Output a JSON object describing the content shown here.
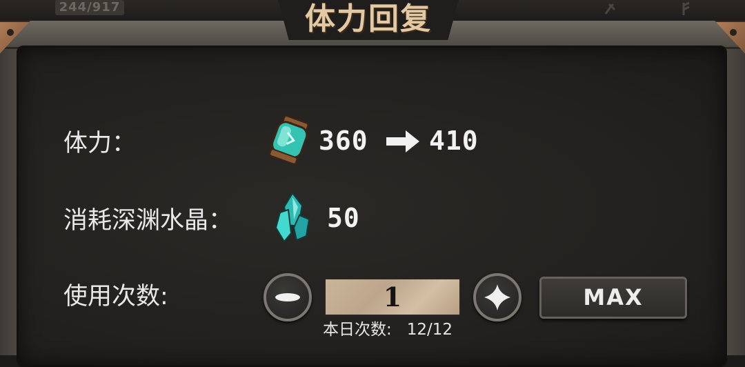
{
  "header": {
    "counter_text": "244/917",
    "title": "体力回复"
  },
  "rows": {
    "stamina": {
      "label": "体力：",
      "icon": "stamina-bottle-icon",
      "from_value": "360",
      "to_value": "410",
      "arrow_icon": "right-arrow-icon"
    },
    "cost": {
      "label": "消耗深渊水晶：",
      "icon": "abyss-crystal-icon",
      "value": "50"
    },
    "uses": {
      "label": "使用次数:",
      "count": "1",
      "max_label": "MAX",
      "minus_icon": "minus-icon",
      "plus_icon": "plus-icon"
    }
  },
  "daily": {
    "label": "本日次数:",
    "value": "12/12"
  },
  "colors": {
    "panel_bg": "#22201e",
    "frame": "#57524a",
    "title_text": "#e3c9a3",
    "crystal": "#3fd1c8",
    "count_box": "#c9b49a",
    "corner": "#b07d58"
  }
}
